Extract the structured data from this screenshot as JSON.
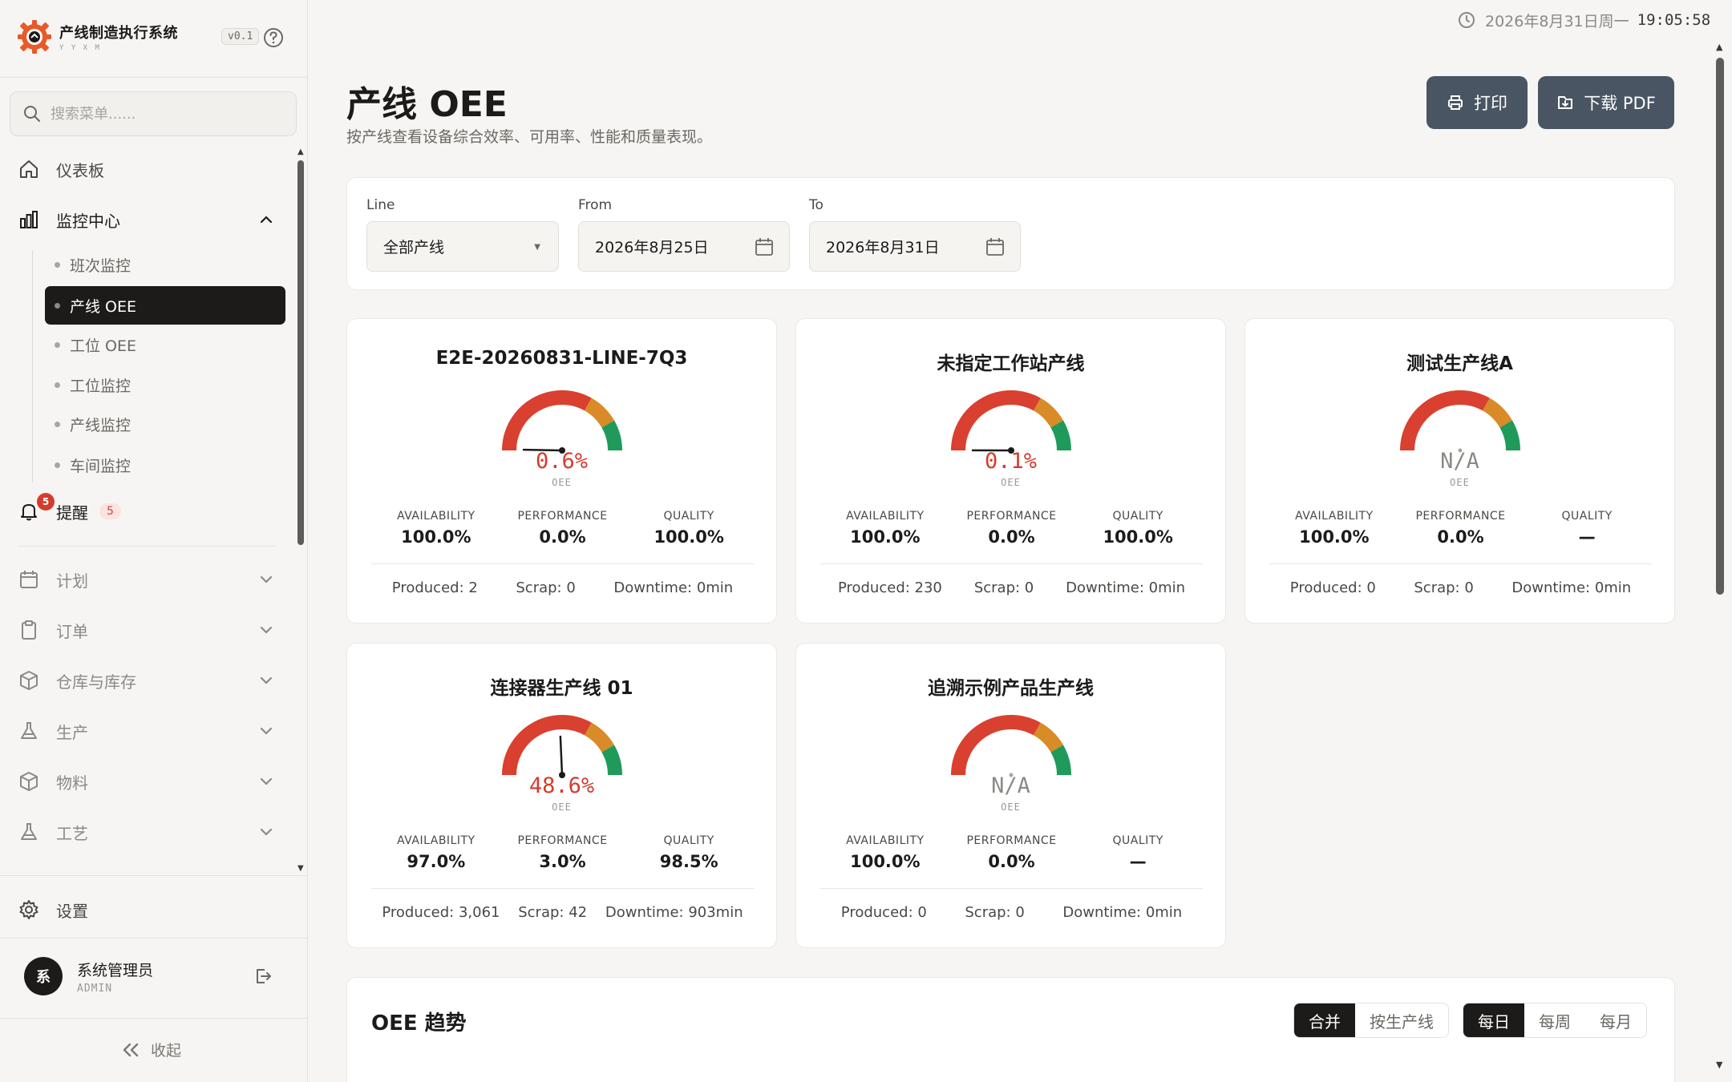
{
  "brand": {
    "title": "产线制造执行系统",
    "subtitle": "Y Y X M",
    "version": "v0.1"
  },
  "search": {
    "placeholder": "搜索菜单......"
  },
  "nav": {
    "dashboard": "仪表板",
    "monitor": "监控中心",
    "monitor_children": [
      "班次监控",
      "产线 OEE",
      "工位 OEE",
      "工位监控",
      "产线监控",
      "车间监控"
    ],
    "alerts": "提醒",
    "alerts_count": "5",
    "alerts_badge": "5",
    "plan": "计划",
    "orders": "订单",
    "warehouse": "仓库与库存",
    "production": "生产",
    "materials": "物料",
    "process": "工艺",
    "settings": "设置",
    "collapse": "收起"
  },
  "user": {
    "name": "系统管理员",
    "role": "ADMIN",
    "initial": "系"
  },
  "clock": {
    "date": "2026年8月31日周一",
    "time": "19:05:58"
  },
  "header": {
    "title": "产线 OEE",
    "description": "按产线查看设备综合效率、可用率、性能和质量表现。",
    "print": "打印",
    "download_pdf": "下载 PDF"
  },
  "filters": {
    "line_label": "Line",
    "line_value": "全部产线",
    "from_label": "From",
    "from_value": "2026年8月25日",
    "to_label": "To",
    "to_value": "2026年8月31日"
  },
  "metric_labels": {
    "availability": "AVAILABILITY",
    "performance": "PERFORMANCE",
    "quality": "QUALITY",
    "oee": "OEE"
  },
  "lines": [
    {
      "name": "E2E-20260831-LINE-7Q3",
      "oee": "0.6%",
      "oee_fraction": 0.006,
      "availability": "100.0%",
      "performance": "0.0%",
      "quality": "100.0%",
      "produced": "Produced: 2",
      "scrap": "Scrap: 0",
      "downtime": "Downtime: 0min"
    },
    {
      "name": "未指定工作站产线",
      "oee": "0.1%",
      "oee_fraction": 0.001,
      "availability": "100.0%",
      "performance": "0.0%",
      "quality": "100.0%",
      "produced": "Produced: 230",
      "scrap": "Scrap: 0",
      "downtime": "Downtime: 0min"
    },
    {
      "name": "测试生产线A",
      "oee": "N/A",
      "oee_fraction": null,
      "availability": "100.0%",
      "performance": "0.0%",
      "quality": "—",
      "produced": "Produced: 0",
      "scrap": "Scrap: 0",
      "downtime": "Downtime: 0min"
    },
    {
      "name": "连接器生产线 01",
      "oee": "48.6%",
      "oee_fraction": 0.486,
      "availability": "97.0%",
      "performance": "3.0%",
      "quality": "98.5%",
      "produced": "Produced: 3,061",
      "scrap": "Scrap: 42",
      "downtime": "Downtime: 903min"
    },
    {
      "name": "追溯示例产品生产线",
      "oee": "N/A",
      "oee_fraction": null,
      "availability": "100.0%",
      "performance": "0.0%",
      "quality": "—",
      "produced": "Produced: 0",
      "scrap": "Scrap: 0",
      "downtime": "Downtime: 0min"
    }
  ],
  "trend": {
    "title": "OEE 趋势",
    "mode_merged": "合并",
    "mode_by_line": "按生产线",
    "daily": "每日",
    "weekly": "每周",
    "monthly": "每月"
  },
  "colors": {
    "gauge_red": "#d9402f",
    "gauge_orange": "#d98b27",
    "gauge_green": "#1f9a5a",
    "primary_button": "#4a5563",
    "active_nav": "#1c1b1a"
  },
  "icons": {
    "logo": "gear-logo-icon",
    "help": "question-circle-icon",
    "search": "search-icon",
    "clock": "clock-icon",
    "print": "printer-icon",
    "pdf": "download-icon",
    "calendar": "calendar-icon"
  }
}
